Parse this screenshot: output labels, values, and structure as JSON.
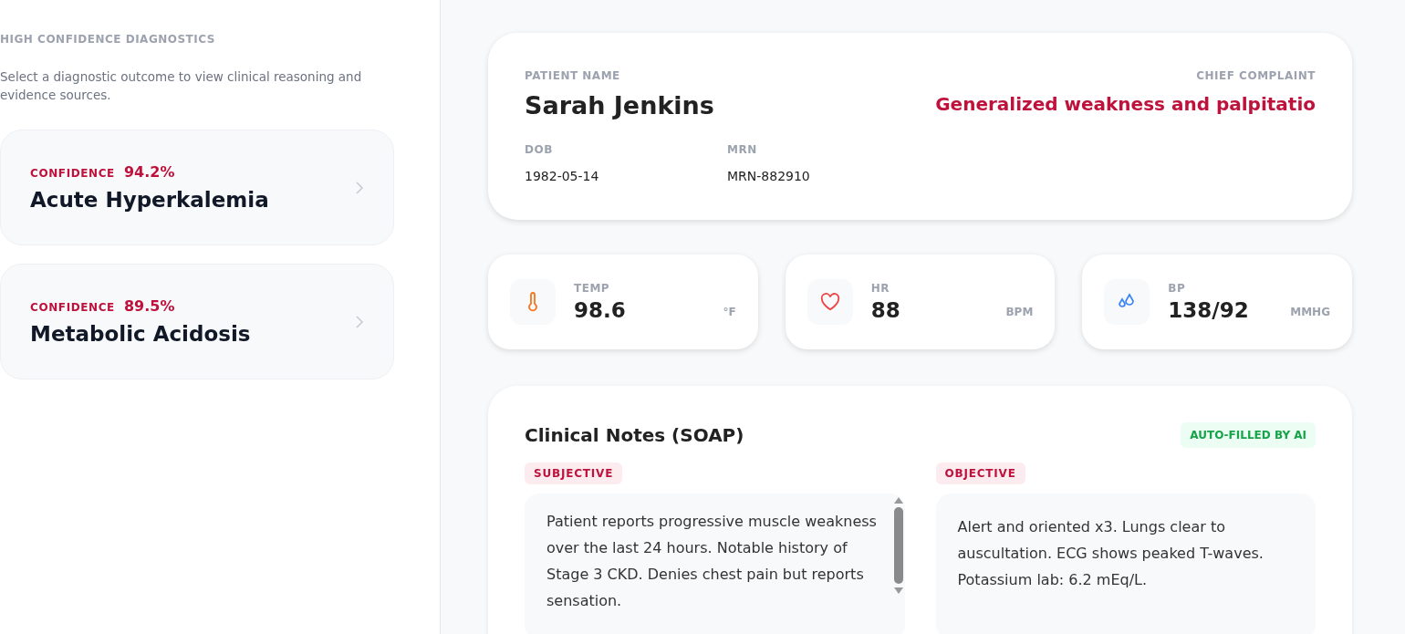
{
  "sidebar": {
    "heading": "HIGH CONFIDENCE DIAGNOSTICS",
    "description": "Select a diagnostic outcome to view clinical reasoning and evidence sources.",
    "diagnoses": [
      {
        "confidence_label": "CONFIDENCE",
        "confidence": "94.2%",
        "name": "Acute Hyperkalemia"
      },
      {
        "confidence_label": "CONFIDENCE",
        "confidence": "89.5%",
        "name": "Metabolic Acidosis"
      }
    ]
  },
  "patient": {
    "name_label": "PATIENT NAME",
    "name": "Sarah Jenkins",
    "complaint_label": "CHIEF COMPLAINT",
    "complaint": "Generalized weakness and palpitatio",
    "dob_label": "DOB",
    "dob": "1982-05-14",
    "mrn_label": "MRN",
    "mrn": "MRN-882910"
  },
  "vitals": [
    {
      "kind": "temp",
      "label": "TEMP",
      "value": "98.6",
      "unit": "°F"
    },
    {
      "kind": "heart",
      "label": "HR",
      "value": "88",
      "unit": "BPM"
    },
    {
      "kind": "pressure",
      "label": "BP",
      "value": "138/92",
      "unit": "MMHG"
    }
  ],
  "notes": {
    "title": "Clinical Notes (SOAP)",
    "badge": "AUTO-FILLED BY AI",
    "sections": [
      {
        "label": "SUBJECTIVE",
        "text": "Patient reports progressive muscle weakness over the last 24 hours. Notable history of Stage 3 CKD. Denies chest pain but reports sensation.",
        "scrollable": true
      },
      {
        "label": "OBJECTIVE",
        "text": "Alert and oriented x3. Lungs clear to auscultation. ECG shows peaked T-waves. Potassium lab: 6.2 mEq/L.",
        "scrollable": false
      }
    ]
  }
}
